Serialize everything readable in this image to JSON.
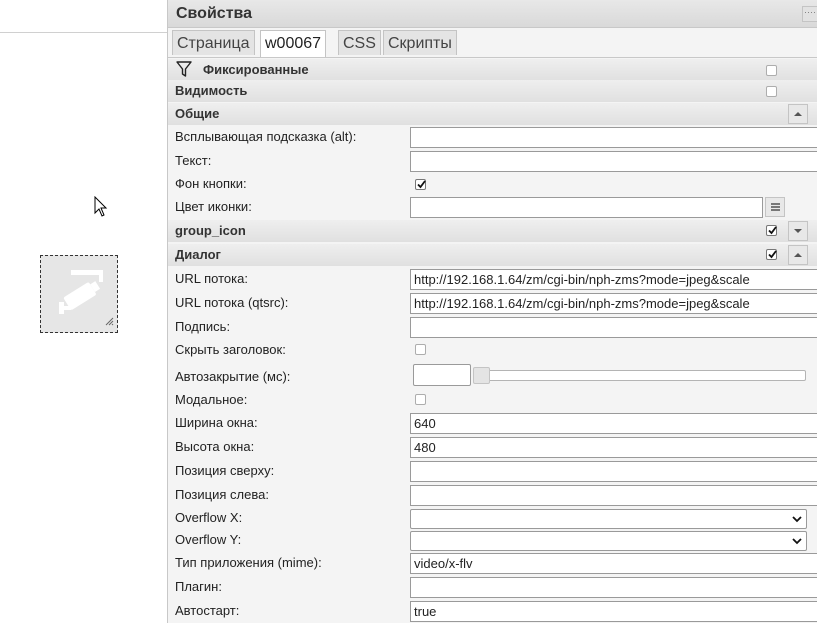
{
  "panel": {
    "title": "Свойства",
    "tabs": [
      {
        "label": "Страница",
        "active": false
      },
      {
        "label": "w00067",
        "active": true
      },
      {
        "label": "CSS",
        "active": false
      },
      {
        "label": "Скрипты",
        "active": false
      }
    ]
  },
  "groups": {
    "fixed": {
      "label": "Фиксированные",
      "checked": false
    },
    "visibility": {
      "label": "Видимость",
      "checked": false
    },
    "common": {
      "label": "Общие"
    },
    "group_icon": {
      "label": "group_icon",
      "checked": true
    },
    "dialog": {
      "label": "Диалог",
      "checked": true
    }
  },
  "common": {
    "tooltip_label": "Всплывающая подсказка (alt):",
    "tooltip_value": "",
    "text_label": "Текст:",
    "text_value": "",
    "button_bg_label": "Фон кнопки:",
    "button_bg_checked": true,
    "icon_color_label": "Цвет иконки:",
    "icon_color_value": ""
  },
  "dialog": {
    "url_label": "URL потока:",
    "url_value": "http://192.168.1.64/zm/cgi-bin/nph-zms?mode=jpeg&scale",
    "url_qtsrc_label": "URL потока (qtsrc):",
    "url_qtsrc_value": "http://192.168.1.64/zm/cgi-bin/nph-zms?mode=jpeg&scale",
    "caption_label": "Подпись:",
    "caption_value": "",
    "hide_title_label": "Скрыть заголовок:",
    "hide_title_checked": false,
    "autoclose_label": "Автозакрытие (мс):",
    "autoclose_value": "",
    "modal_label": "Модальное:",
    "modal_checked": false,
    "width_label": "Ширина окна:",
    "width_value": "640",
    "height_label": "Высота окна:",
    "height_value": "480",
    "top_label": "Позиция сверху:",
    "top_value": "",
    "left_label": "Позиция слева:",
    "left_value": "",
    "overflow_x_label": "Overflow X:",
    "overflow_x_value": "",
    "overflow_y_label": "Overflow Y:",
    "overflow_y_value": "",
    "mime_label": "Тип приложения (mime):",
    "mime_value": "video/x-flv",
    "plugin_label": "Плагин:",
    "plugin_value": "",
    "autostart_label": "Автостарт:",
    "autostart_value": "true"
  },
  "icons": {
    "filter": "filter-icon",
    "camera": "camera-icon",
    "cursor": "mouse-cursor-icon"
  }
}
